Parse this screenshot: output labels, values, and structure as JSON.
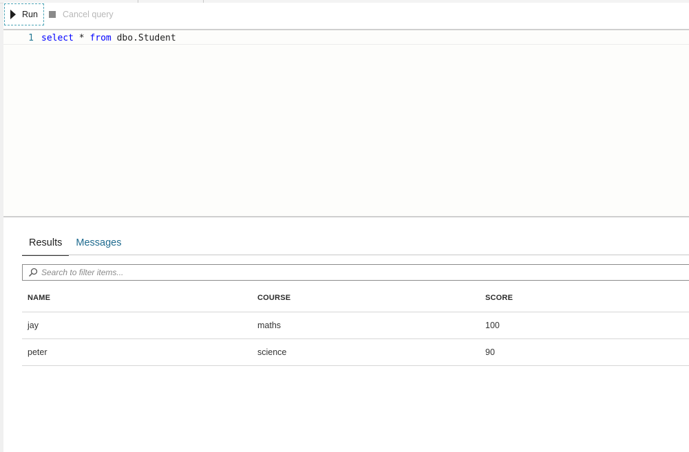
{
  "toolbar": {
    "run_label": "Run",
    "cancel_label": "Cancel query"
  },
  "editor": {
    "line_number": "1",
    "tokens": {
      "select": "select",
      "star": " * ",
      "from": "from",
      "table": " dbo.Student"
    }
  },
  "results": {
    "tabs": [
      {
        "label": "Results",
        "active": true
      },
      {
        "label": "Messages",
        "active": false
      }
    ],
    "search": {
      "placeholder": "Search to filter items..."
    },
    "columns": [
      "NAME",
      "COURSE",
      "SCORE"
    ],
    "rows": [
      [
        "jay",
        "maths",
        "100"
      ],
      [
        "peter",
        "science",
        "90"
      ]
    ]
  },
  "colors": {
    "keyword": "#0000ff",
    "line_number": "#237893",
    "link_tab": "#1f6b8f",
    "run_focus_border": "#4aa3b5"
  },
  "icons": {
    "run": "play-icon",
    "cancel": "stop-icon",
    "search": "search-icon"
  }
}
